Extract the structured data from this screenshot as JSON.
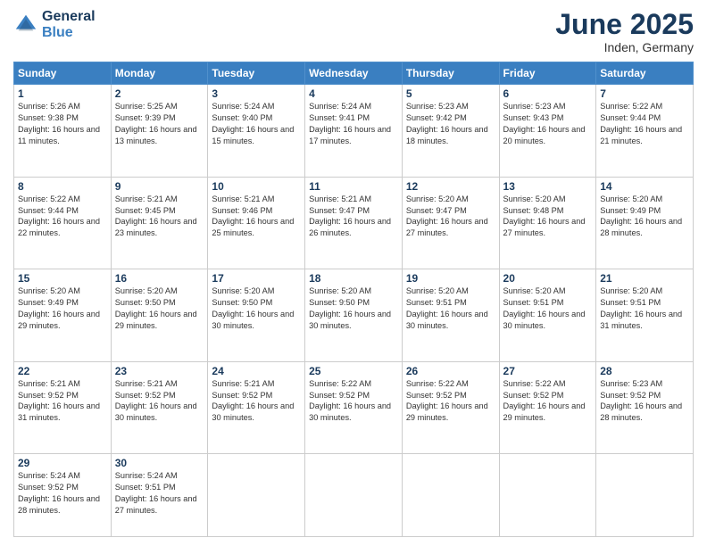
{
  "logo": {
    "line1": "General",
    "line2": "Blue"
  },
  "title": "June 2025",
  "subtitle": "Inden, Germany",
  "days_of_week": [
    "Sunday",
    "Monday",
    "Tuesday",
    "Wednesday",
    "Thursday",
    "Friday",
    "Saturday"
  ],
  "weeks": [
    [
      {
        "day": "1",
        "sunrise": "5:26 AM",
        "sunset": "9:38 PM",
        "daylight": "16 hours and 11 minutes."
      },
      {
        "day": "2",
        "sunrise": "5:25 AM",
        "sunset": "9:39 PM",
        "daylight": "16 hours and 13 minutes."
      },
      {
        "day": "3",
        "sunrise": "5:24 AM",
        "sunset": "9:40 PM",
        "daylight": "16 hours and 15 minutes."
      },
      {
        "day": "4",
        "sunrise": "5:24 AM",
        "sunset": "9:41 PM",
        "daylight": "16 hours and 17 minutes."
      },
      {
        "day": "5",
        "sunrise": "5:23 AM",
        "sunset": "9:42 PM",
        "daylight": "16 hours and 18 minutes."
      },
      {
        "day": "6",
        "sunrise": "5:23 AM",
        "sunset": "9:43 PM",
        "daylight": "16 hours and 20 minutes."
      },
      {
        "day": "7",
        "sunrise": "5:22 AM",
        "sunset": "9:44 PM",
        "daylight": "16 hours and 21 minutes."
      }
    ],
    [
      {
        "day": "8",
        "sunrise": "5:22 AM",
        "sunset": "9:44 PM",
        "daylight": "16 hours and 22 minutes."
      },
      {
        "day": "9",
        "sunrise": "5:21 AM",
        "sunset": "9:45 PM",
        "daylight": "16 hours and 23 minutes."
      },
      {
        "day": "10",
        "sunrise": "5:21 AM",
        "sunset": "9:46 PM",
        "daylight": "16 hours and 25 minutes."
      },
      {
        "day": "11",
        "sunrise": "5:21 AM",
        "sunset": "9:47 PM",
        "daylight": "16 hours and 26 minutes."
      },
      {
        "day": "12",
        "sunrise": "5:20 AM",
        "sunset": "9:47 PM",
        "daylight": "16 hours and 27 minutes."
      },
      {
        "day": "13",
        "sunrise": "5:20 AM",
        "sunset": "9:48 PM",
        "daylight": "16 hours and 27 minutes."
      },
      {
        "day": "14",
        "sunrise": "5:20 AM",
        "sunset": "9:49 PM",
        "daylight": "16 hours and 28 minutes."
      }
    ],
    [
      {
        "day": "15",
        "sunrise": "5:20 AM",
        "sunset": "9:49 PM",
        "daylight": "16 hours and 29 minutes."
      },
      {
        "day": "16",
        "sunrise": "5:20 AM",
        "sunset": "9:50 PM",
        "daylight": "16 hours and 29 minutes."
      },
      {
        "day": "17",
        "sunrise": "5:20 AM",
        "sunset": "9:50 PM",
        "daylight": "16 hours and 30 minutes."
      },
      {
        "day": "18",
        "sunrise": "5:20 AM",
        "sunset": "9:50 PM",
        "daylight": "16 hours and 30 minutes."
      },
      {
        "day": "19",
        "sunrise": "5:20 AM",
        "sunset": "9:51 PM",
        "daylight": "16 hours and 30 minutes."
      },
      {
        "day": "20",
        "sunrise": "5:20 AM",
        "sunset": "9:51 PM",
        "daylight": "16 hours and 30 minutes."
      },
      {
        "day": "21",
        "sunrise": "5:20 AM",
        "sunset": "9:51 PM",
        "daylight": "16 hours and 31 minutes."
      }
    ],
    [
      {
        "day": "22",
        "sunrise": "5:21 AM",
        "sunset": "9:52 PM",
        "daylight": "16 hours and 31 minutes."
      },
      {
        "day": "23",
        "sunrise": "5:21 AM",
        "sunset": "9:52 PM",
        "daylight": "16 hours and 30 minutes."
      },
      {
        "day": "24",
        "sunrise": "5:21 AM",
        "sunset": "9:52 PM",
        "daylight": "16 hours and 30 minutes."
      },
      {
        "day": "25",
        "sunrise": "5:22 AM",
        "sunset": "9:52 PM",
        "daylight": "16 hours and 30 minutes."
      },
      {
        "day": "26",
        "sunrise": "5:22 AM",
        "sunset": "9:52 PM",
        "daylight": "16 hours and 29 minutes."
      },
      {
        "day": "27",
        "sunrise": "5:22 AM",
        "sunset": "9:52 PM",
        "daylight": "16 hours and 29 minutes."
      },
      {
        "day": "28",
        "sunrise": "5:23 AM",
        "sunset": "9:52 PM",
        "daylight": "16 hours and 28 minutes."
      }
    ],
    [
      {
        "day": "29",
        "sunrise": "5:24 AM",
        "sunset": "9:52 PM",
        "daylight": "16 hours and 28 minutes."
      },
      {
        "day": "30",
        "sunrise": "5:24 AM",
        "sunset": "9:51 PM",
        "daylight": "16 hours and 27 minutes."
      },
      null,
      null,
      null,
      null,
      null
    ]
  ],
  "labels": {
    "sunrise": "Sunrise:",
    "sunset": "Sunset:",
    "daylight": "Daylight:"
  }
}
